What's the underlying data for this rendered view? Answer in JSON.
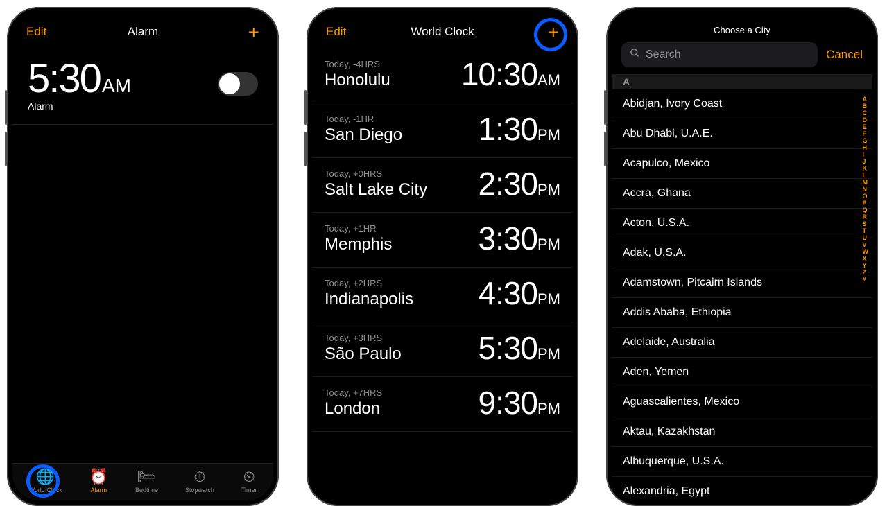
{
  "phone1": {
    "nav": {
      "left": "Edit",
      "title": "Alarm",
      "right": "+"
    },
    "alarm": {
      "time": "5:30",
      "ampm": "AM",
      "label": "Alarm",
      "on": false
    },
    "tabs": [
      {
        "name": "World Clock",
        "glyph": "🌐"
      },
      {
        "name": "Alarm",
        "glyph": "⏰"
      },
      {
        "name": "Bedtime",
        "glyph": "🛏"
      },
      {
        "name": "Stopwatch",
        "glyph": "⏱"
      },
      {
        "name": "Timer",
        "glyph": "⏲"
      }
    ],
    "active_tab": 1,
    "highlight_tab_index": 0
  },
  "phone2": {
    "nav": {
      "left": "Edit",
      "title": "World Clock",
      "right": "+"
    },
    "highlight_add": true,
    "cities": [
      {
        "meta": "Today, -4HRS",
        "city": "Honolulu",
        "time": "10:30",
        "ampm": "AM"
      },
      {
        "meta": "Today, -1HR",
        "city": "San Diego",
        "time": "1:30",
        "ampm": "PM"
      },
      {
        "meta": "Today, +0HRS",
        "city": "Salt Lake City",
        "time": "2:30",
        "ampm": "PM"
      },
      {
        "meta": "Today, +1HR",
        "city": "Memphis",
        "time": "3:30",
        "ampm": "PM"
      },
      {
        "meta": "Today, +2HRS",
        "city": "Indianapolis",
        "time": "4:30",
        "ampm": "PM"
      },
      {
        "meta": "Today, +3HRS",
        "city": "São Paulo",
        "time": "5:30",
        "ampm": "PM"
      },
      {
        "meta": "Today, +7HRS",
        "city": "London",
        "time": "9:30",
        "ampm": "PM"
      }
    ],
    "tabs_active": 0
  },
  "phone3": {
    "title": "Choose a City",
    "search_placeholder": "Search",
    "cancel": "Cancel",
    "section": "A",
    "cities": [
      "Abidjan, Ivory Coast",
      "Abu Dhabi, U.A.E.",
      "Acapulco, Mexico",
      "Accra, Ghana",
      "Acton, U.S.A.",
      "Adak, U.S.A.",
      "Adamstown, Pitcairn Islands",
      "Addis Ababa, Ethiopia",
      "Adelaide, Australia",
      "Aden, Yemen",
      "Aguascalientes, Mexico",
      "Aktau, Kazakhstan",
      "Albuquerque, U.S.A.",
      "Alexandria, Egypt"
    ],
    "index": [
      "A",
      "B",
      "C",
      "D",
      "E",
      "F",
      "G",
      "H",
      "I",
      "J",
      "K",
      "L",
      "M",
      "N",
      "O",
      "P",
      "Q",
      "R",
      "S",
      "T",
      "U",
      "V",
      "W",
      "X",
      "Y",
      "Z",
      "#"
    ]
  }
}
